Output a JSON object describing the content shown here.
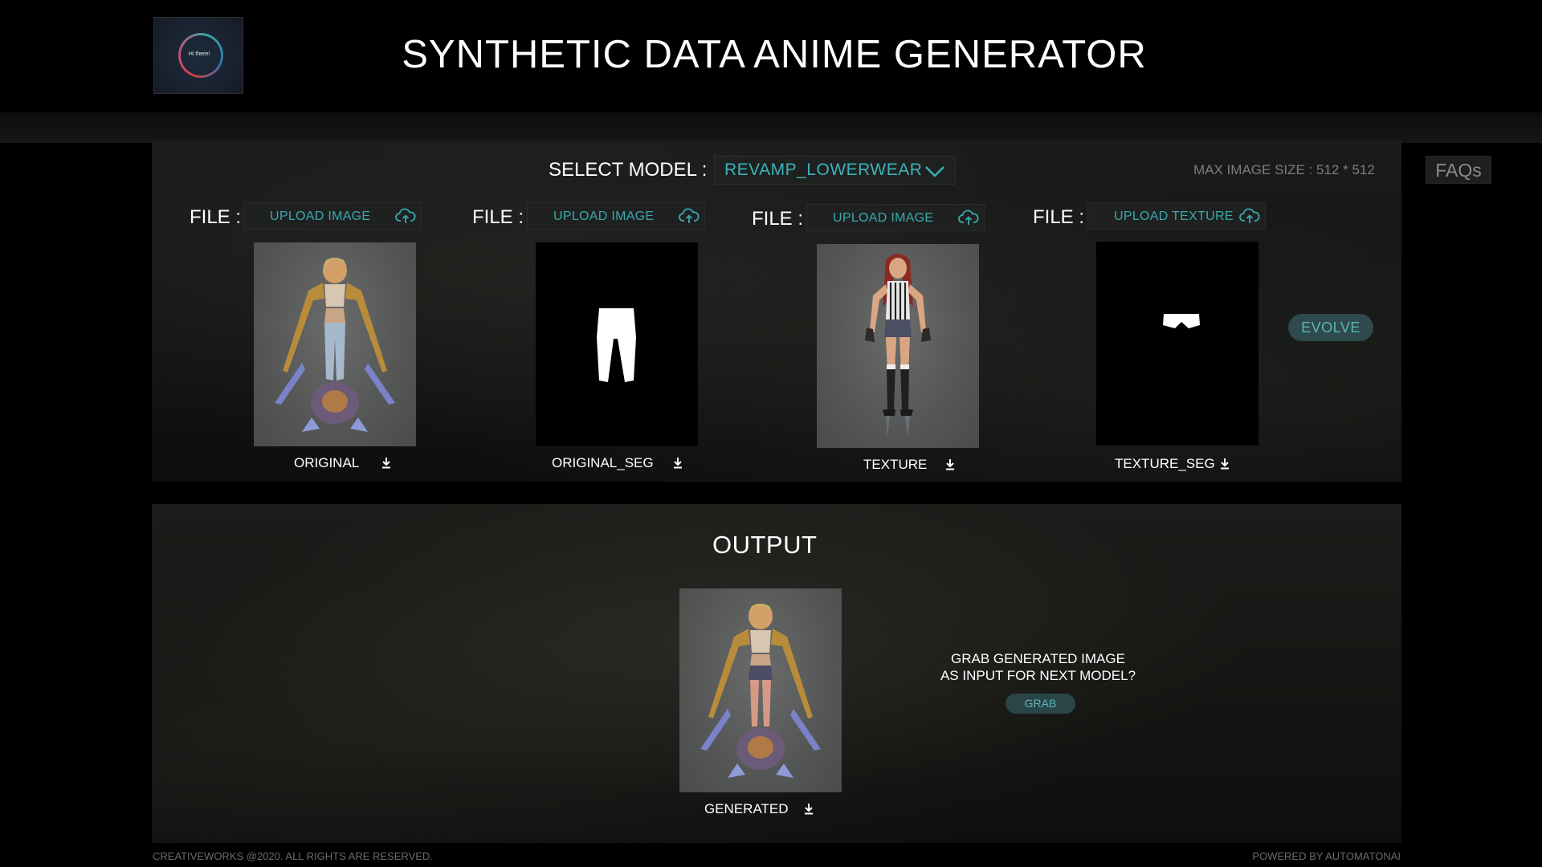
{
  "header": {
    "title": "SYNTHETIC DATA ANIME GENERATOR",
    "logo_text": "Hi there!"
  },
  "controls": {
    "select_label": "SELECT MODEL :",
    "selected_model": "REVAMP_LOWERWEAR",
    "max_size": "MAX IMAGE SIZE : 512 * 512",
    "faqs_label": "FAQs"
  },
  "inputs": [
    {
      "file_label": "FILE :",
      "upload_label": "UPLOAD IMAGE",
      "caption": "ORIGINAL"
    },
    {
      "file_label": "FILE :",
      "upload_label": "UPLOAD IMAGE",
      "caption": "ORIGINAL_SEG"
    },
    {
      "file_label": "FILE :",
      "upload_label": "UPLOAD IMAGE",
      "caption": "TEXTURE"
    },
    {
      "file_label": "FILE :",
      "upload_label": "UPLOAD TEXTURE",
      "caption": "TEXTURE_SEG"
    }
  ],
  "evolve_label": "EVOLVE",
  "output": {
    "title": "OUTPUT",
    "caption": "GENERATED",
    "grab_question_line1": "GRAB GENERATED IMAGE",
    "grab_question_line2": "AS INPUT FOR NEXT MODEL?",
    "grab_label": "GRAB"
  },
  "footer": {
    "left": "CREATIVEWORKS @2020. ALL RIGHTS ARE RESERVED.",
    "right": "POWERED BY AUTOMATONAI"
  },
  "colors": {
    "accent": "#3bb3b7",
    "button_bg": "#2f4a4c",
    "panel_bg": "#151614"
  },
  "icons": [
    "cloud-upload-icon",
    "chevron-down-icon",
    "download-icon"
  ]
}
